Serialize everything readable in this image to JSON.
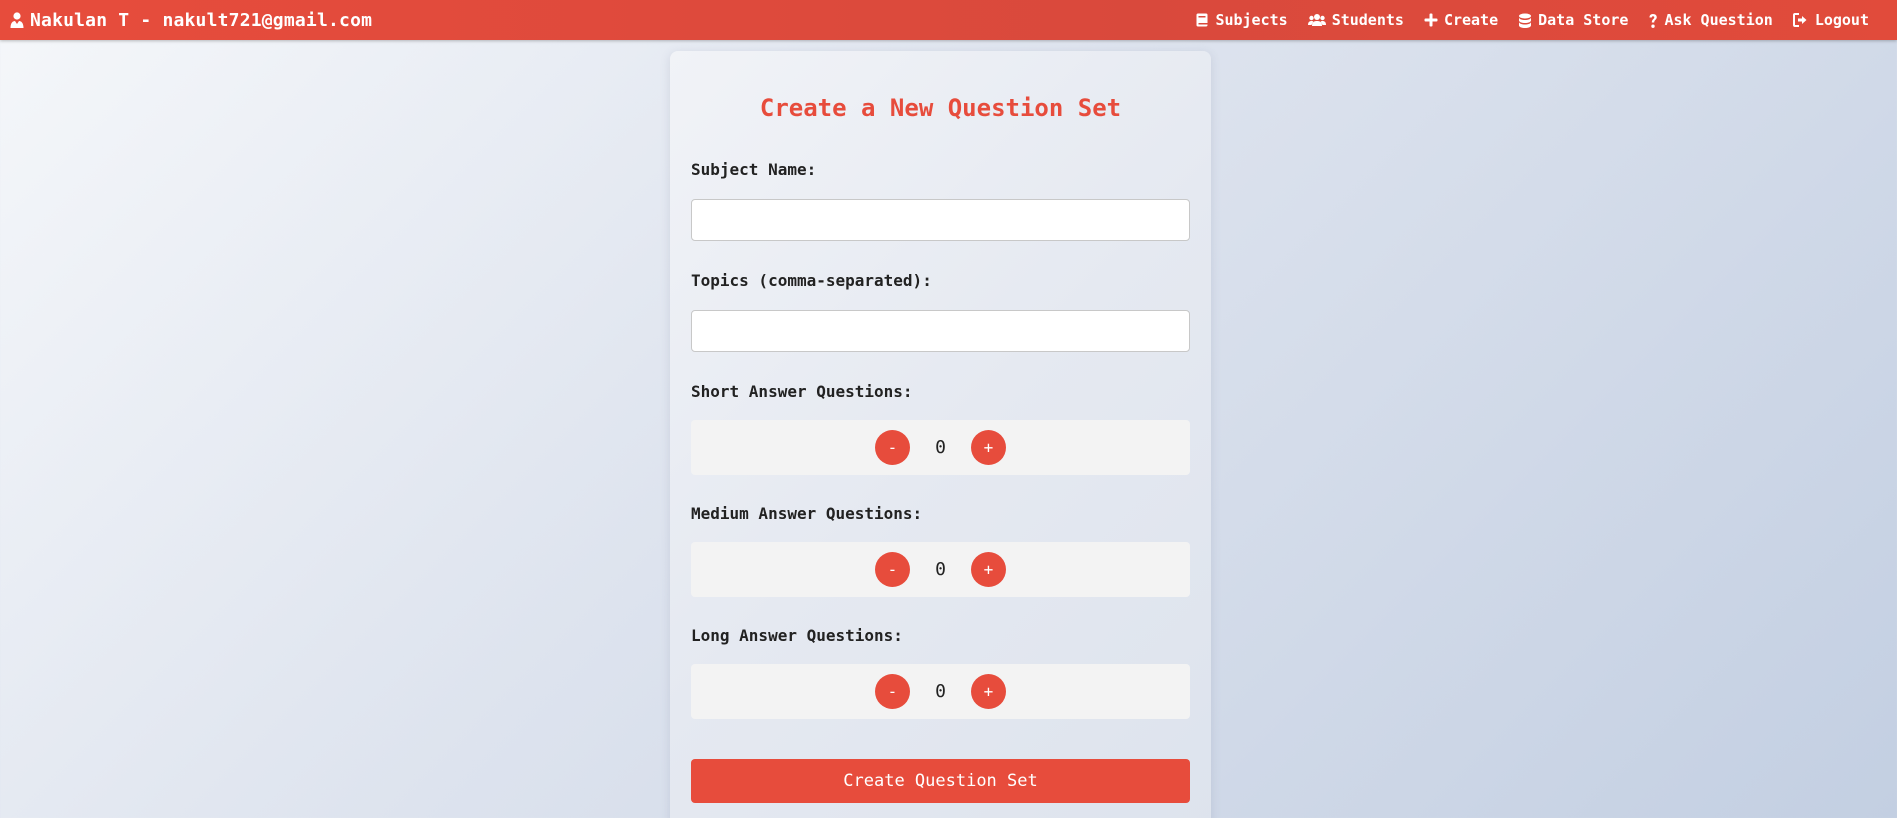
{
  "user": {
    "name_email": "Nakulan T - nakult721@gmail.com",
    "icon": "user-tie-icon"
  },
  "nav": {
    "items": [
      {
        "label": "Subjects",
        "icon": "book-icon"
      },
      {
        "label": "Students",
        "icon": "users-icon"
      },
      {
        "label": "Create",
        "icon": "plus-icon"
      },
      {
        "label": "Data Store",
        "icon": "database-icon"
      },
      {
        "label": "Ask Question",
        "icon": "question-icon"
      },
      {
        "label": "Logout",
        "icon": "logout-icon"
      }
    ]
  },
  "form": {
    "title": "Create a New Question Set",
    "subject_label": "Subject Name:",
    "subject_value": "",
    "topics_label": "Topics (comma-separated):",
    "topics_value": "",
    "short_label": "Short Answer Questions:",
    "short_value": "0",
    "medium_label": "Medium Answer Questions:",
    "medium_value": "0",
    "long_label": "Long Answer Questions:",
    "long_value": "0",
    "minus_label": "-",
    "plus_label": "+",
    "submit_label": "Create Question Set"
  },
  "colors": {
    "accent": "#e74c3c",
    "stepper_bg": "#f3f3f3"
  }
}
